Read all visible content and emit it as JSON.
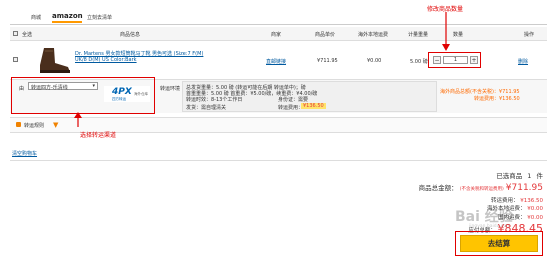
{
  "tabs": {
    "label": "商城",
    "logo": "amazon",
    "direct": "立刻去清单"
  },
  "table_header": {
    "select_all": "全选",
    "product": "商品信息",
    "merchant": "商家",
    "price": "商品单价",
    "domestic_fee": "海外本地运费",
    "weight": "计量重量",
    "qty": "数量",
    "op": "操作"
  },
  "annotation_qty": "修改商品数量",
  "annotation_forward": "选择转运渠道",
  "product": {
    "name_line1": "Dr. Martens 男女款短筒靴马丁靴 男色可选 (Size:7 F(M)",
    "name_line2": "UK/8 D(M) US Color:Bark",
    "merchant": "直邮链接",
    "price": "¥711.95",
    "domestic": "¥0.00",
    "weight": "5.00 磅",
    "qty": "1",
    "delete": "删除"
  },
  "forward": {
    "from_label": "由",
    "select_value": "转运四方-乐清线",
    "logo_text": "4PX",
    "logo_sub": "四方转运",
    "logo_side": "海外仓库",
    "service_label": "转运环境",
    "info_line1": "总发货重量：5.00 磅 (转运可能在后期 转运单中)；磅",
    "info_line2": "首重重量：5.00 磅 首重费：¥5.00/磅，续重费：¥4.00/磅",
    "info_line3": "转运时效：8-13个工作日",
    "tax_label": "身份证：需要",
    "ship_label": "发货：需自理清关",
    "fee_label": "转运费用：",
    "fee_value": "¥136.50",
    "right1": "海外商品总额(不含关税)：¥711.95",
    "right2": "转运费用：¥136.50"
  },
  "rules_link": "转运规则",
  "clear_cart": "清空购物车",
  "summary": {
    "selected_label": "已选商品",
    "selected_count": "1",
    "selected_unit": "件",
    "total_label": "商品总金额：",
    "total_note": "(不含关税和转运费用)",
    "total_value": "¥711.95",
    "forward_label": "转运费用：",
    "forward_value": "¥136.50",
    "local_label": "海外本地运费：",
    "local_value": "¥0.00",
    "domestic_label": "国内运费：",
    "domestic_value": "¥0.00",
    "grand_label": "应付总额：",
    "grand_value": "¥848.45",
    "checkout": "去结算"
  },
  "watermark": "Bai 经验",
  "watermark_sub": "jingyan.baidu.com",
  "colors": {
    "accent": "#e4393c",
    "checkout": "#ffc400",
    "annotation": "#e00000"
  }
}
